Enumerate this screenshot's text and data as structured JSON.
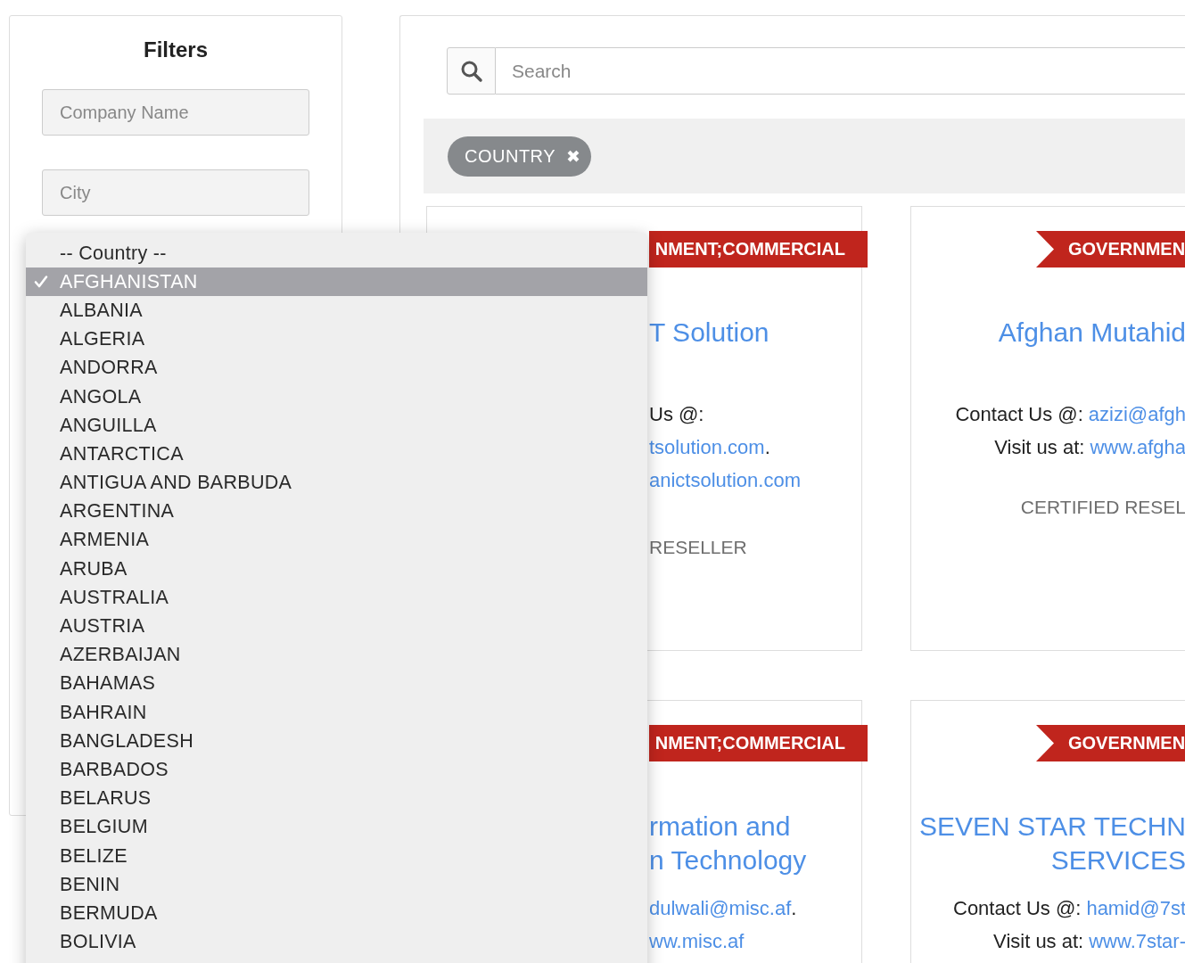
{
  "filters": {
    "title": "Filters",
    "fields": [
      {
        "placeholder": "Company Name"
      },
      {
        "placeholder": "City"
      }
    ]
  },
  "country_dropdown": {
    "options": [
      {
        "label": "-- Country --",
        "selected": false
      },
      {
        "label": "AFGHANISTAN",
        "selected": true
      },
      {
        "label": "ALBANIA",
        "selected": false
      },
      {
        "label": "ALGERIA",
        "selected": false
      },
      {
        "label": "ANDORRA",
        "selected": false
      },
      {
        "label": "ANGOLA",
        "selected": false
      },
      {
        "label": "ANGUILLA",
        "selected": false
      },
      {
        "label": "ANTARCTICA",
        "selected": false
      },
      {
        "label": "ANTIGUA AND BARBUDA",
        "selected": false
      },
      {
        "label": "ARGENTINA",
        "selected": false
      },
      {
        "label": "ARMENIA",
        "selected": false
      },
      {
        "label": "ARUBA",
        "selected": false
      },
      {
        "label": "AUSTRALIA",
        "selected": false
      },
      {
        "label": "AUSTRIA",
        "selected": false
      },
      {
        "label": "AZERBAIJAN",
        "selected": false
      },
      {
        "label": "BAHAMAS",
        "selected": false
      },
      {
        "label": "BAHRAIN",
        "selected": false
      },
      {
        "label": "BANGLADESH",
        "selected": false
      },
      {
        "label": "BARBADOS",
        "selected": false
      },
      {
        "label": "BELARUS",
        "selected": false
      },
      {
        "label": "BELGIUM",
        "selected": false
      },
      {
        "label": "BELIZE",
        "selected": false
      },
      {
        "label": "BENIN",
        "selected": false
      },
      {
        "label": "BERMUDA",
        "selected": false
      },
      {
        "label": "BOLIVIA",
        "selected": false
      }
    ]
  },
  "search": {
    "placeholder": "Search"
  },
  "active_filters": [
    {
      "label": "COUNTRY",
      "remove": "✖"
    }
  ],
  "cards": [
    {
      "kind": "covered",
      "tag": "NMENT;COMMERCIAL",
      "title": [
        "T Solution"
      ],
      "lines": [
        {
          "kind": "contact",
          "label": "Us @:"
        },
        {
          "kind": "contact",
          "link": "tsolution.com",
          "suffix": "."
        },
        {
          "kind": "contact",
          "link": "anictsolution.com"
        },
        {
          "kind": "certification",
          "label": "RESELLER"
        }
      ]
    },
    {
      "kind": "edge",
      "tag": "GOVERNMEN",
      "title": [
        "Afghan Mutahid"
      ],
      "lines": [
        {
          "kind": "contact",
          "label": "Contact Us @:",
          "link": "azizi@afgh"
        },
        {
          "kind": "contact",
          "label": "Visit us at:",
          "link": "www.afgha"
        },
        {
          "kind": "certification",
          "label": "CERTIFIED RESEL"
        }
      ]
    },
    {
      "kind": "covered",
      "tag": "NMENT;COMMERCIAL",
      "title": [
        "rmation and",
        "n Technology"
      ],
      "lines": [
        {
          "kind": "contact",
          "link": "dulwali@misc.af",
          "suffix": "."
        },
        {
          "kind": "contact",
          "link": "ww.misc.af"
        }
      ]
    },
    {
      "kind": "edge",
      "tag": "GOVERNMEN",
      "title": [
        "SEVEN STAR TECHN",
        "SERVICES"
      ],
      "lines": [
        {
          "kind": "contact",
          "label": "Contact Us @:",
          "link": "hamid@7st"
        },
        {
          "kind": "contact",
          "label": "Visit us at:",
          "link": "www.7star-"
        }
      ]
    }
  ]
}
